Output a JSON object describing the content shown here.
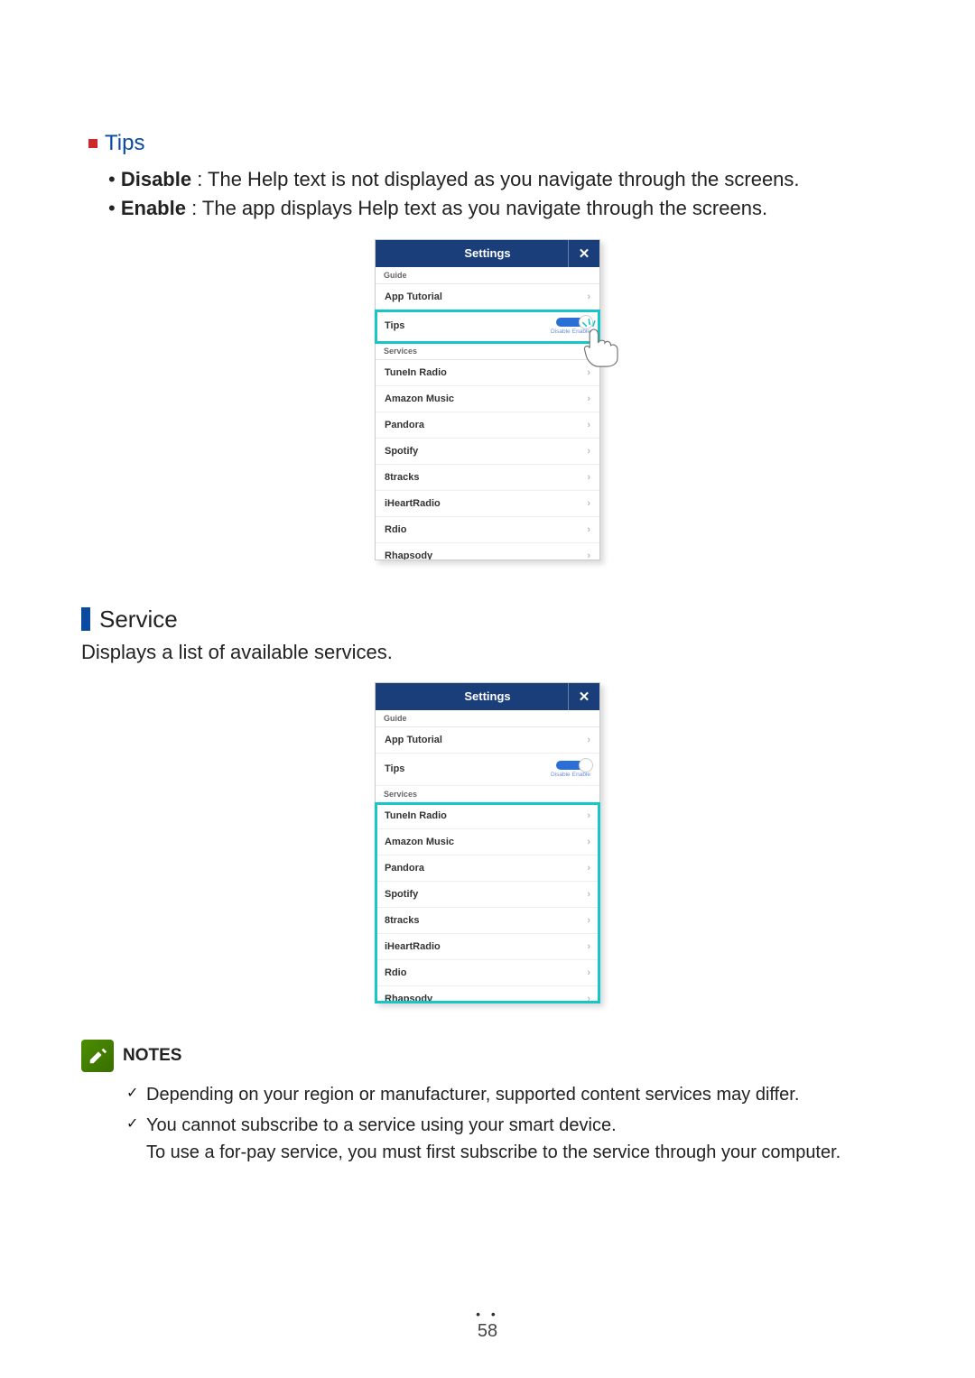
{
  "tips": {
    "heading": "Tips",
    "items": [
      {
        "label": "Disable",
        "text": " : The Help text is not displayed as you navigate through the screens."
      },
      {
        "label": "Enable",
        "text": " : The app displays Help text as you navigate through the screens."
      }
    ]
  },
  "service": {
    "heading": "Service",
    "desc": "Displays a list of available services."
  },
  "phone": {
    "title": "Settings",
    "close_glyph": "✕",
    "section_guide": "Guide",
    "section_services": "Services",
    "rows_guide": [
      {
        "label": "App Tutorial",
        "chevron": "›"
      },
      {
        "label": "Tips",
        "toggle": {
          "left": "Disable",
          "right": "Enable"
        }
      }
    ],
    "rows_services": [
      {
        "label": "TuneIn Radio",
        "chevron": "›"
      },
      {
        "label": "Amazon Music",
        "chevron": "›"
      },
      {
        "label": "Pandora",
        "chevron": "›"
      },
      {
        "label": "Spotify",
        "chevron": "›"
      },
      {
        "label": "8tracks",
        "chevron": "›"
      },
      {
        "label": "iHeartRadio",
        "chevron": "›"
      },
      {
        "label": "Rdio",
        "chevron": "›"
      },
      {
        "label": "Rhapsody",
        "chevron": "›"
      }
    ]
  },
  "notes": {
    "title": "NOTES",
    "items": [
      "Depending on your region or manufacturer, supported content services may differ.",
      "You cannot subscribe to a service using your smart device."
    ],
    "cont": "To use a for-pay service, you must first subscribe to the service through your computer."
  },
  "page_number": "58"
}
